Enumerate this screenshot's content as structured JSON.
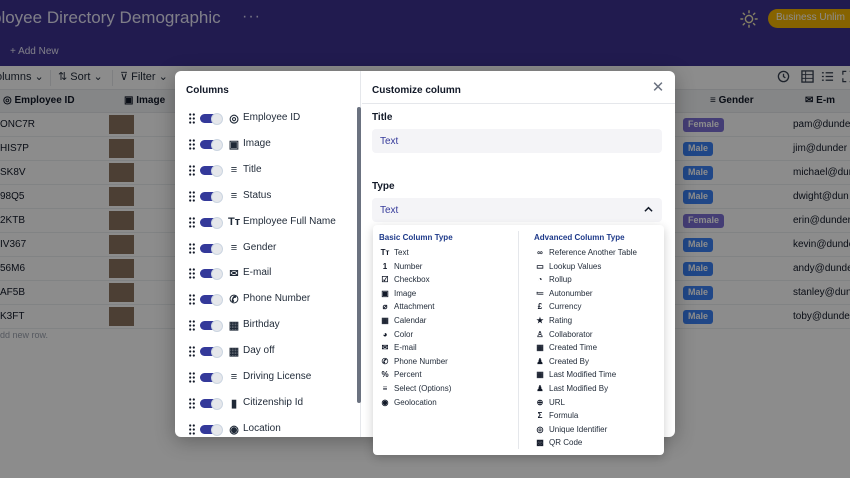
{
  "header": {
    "title": "ployee Directory Demographic",
    "more": "···",
    "plan_badge": "Business Unlim",
    "add_new": "+ Add New"
  },
  "toolbar": {
    "columns": "olumns ⌄",
    "sort": "⇅ Sort ⌄",
    "filter": "⊽ Filter ⌄",
    "history_icon": "history-icon",
    "grid_icon": "grid-view-icon",
    "list_icon": "list-view-icon",
    "expand_icon": "expand-icon"
  },
  "grid": {
    "headers": {
      "id": "Employee ID",
      "image": "Image",
      "gender": "Gender",
      "email": "E-m"
    },
    "rows": [
      {
        "id": "ONC7R",
        "gender": "Female",
        "email": "pam@dunder"
      },
      {
        "id": "HIS7P",
        "gender": "Male",
        "email": "jim@dunder"
      },
      {
        "id": "SK8V",
        "gender": "Male",
        "email": "michael@dun"
      },
      {
        "id": "98Q5",
        "gender": "Male",
        "email": "dwight@dun"
      },
      {
        "id": "2KTB",
        "gender": "Female",
        "email": "erin@dunder"
      },
      {
        "id": "IV367",
        "gender": "Male",
        "email": "kevin@dunde"
      },
      {
        "id": "56M6",
        "gender": "Male",
        "email": "andy@dunder"
      },
      {
        "id": "AF5B",
        "gender": "Male",
        "email": "stanley@dun"
      },
      {
        "id": "K3FT",
        "gender": "Male",
        "email": "toby@dunder"
      }
    ],
    "add_row": "dd new row.",
    "colors": {
      "female": "#7c6fd6",
      "male": "#3b82f6"
    }
  },
  "columns_panel": {
    "title": "Columns",
    "items": [
      {
        "icon": "fingerprint-icon",
        "glyph": "◎",
        "label": "Employee ID"
      },
      {
        "icon": "image-icon",
        "glyph": "▣",
        "label": "Image"
      },
      {
        "icon": "single-select-icon",
        "glyph": "≡",
        "label": "Title"
      },
      {
        "icon": "single-select-icon",
        "glyph": "≡",
        "label": "Status"
      },
      {
        "icon": "text-icon",
        "glyph": "Tт",
        "label": "Employee Full Name"
      },
      {
        "icon": "single-select-icon",
        "glyph": "≡",
        "label": "Gender"
      },
      {
        "icon": "email-icon",
        "glyph": "✉",
        "label": "E-mail"
      },
      {
        "icon": "phone-icon",
        "glyph": "✆",
        "label": "Phone Number"
      },
      {
        "icon": "calendar-icon",
        "glyph": "▦",
        "label": "Birthday"
      },
      {
        "icon": "calendar-icon",
        "glyph": "▦",
        "label": "Day off"
      },
      {
        "icon": "single-select-icon",
        "glyph": "≡",
        "label": "Driving License"
      },
      {
        "icon": "number-icon",
        "glyph": "▮",
        "label": "Citizenship Id"
      },
      {
        "icon": "location-icon",
        "glyph": "◉",
        "label": "Location"
      }
    ]
  },
  "customize": {
    "title": "Customize column",
    "title_label": "Title",
    "title_value": "Text",
    "type_label": "Type",
    "type_value": "Text"
  },
  "type_dropdown": {
    "basic_header": "Basic Column Type",
    "advanced_header": "Advanced Column Type",
    "basic": [
      {
        "icon": "text-icon",
        "glyph": "Tт",
        "label": "Text"
      },
      {
        "icon": "number-icon",
        "glyph": "1",
        "label": "Number"
      },
      {
        "icon": "checkbox-icon",
        "glyph": "☑",
        "label": "Checkbox"
      },
      {
        "icon": "image-icon",
        "glyph": "▣",
        "label": "Image"
      },
      {
        "icon": "attachment-icon",
        "glyph": "⌀",
        "label": "Attachment"
      },
      {
        "icon": "calendar-icon",
        "glyph": "▦",
        "label": "Calendar"
      },
      {
        "icon": "palette-icon",
        "glyph": "◕",
        "label": "Color"
      },
      {
        "icon": "email-icon",
        "glyph": "✉",
        "label": "E-mail"
      },
      {
        "icon": "phone-icon",
        "glyph": "✆",
        "label": "Phone Number"
      },
      {
        "icon": "percent-icon",
        "glyph": "%",
        "label": "Percent"
      },
      {
        "icon": "select-icon",
        "glyph": "≡",
        "label": "Select (Options)"
      },
      {
        "icon": "location-icon",
        "glyph": "◉",
        "label": "Geolocation"
      }
    ],
    "advanced": [
      {
        "icon": "link-icon",
        "glyph": "∞",
        "label": "Reference Another Table"
      },
      {
        "icon": "lookup-icon",
        "glyph": "▭",
        "label": "Lookup Values"
      },
      {
        "icon": "rollup-icon",
        "glyph": "◔",
        "label": "Rollup"
      },
      {
        "icon": "autonumber-icon",
        "glyph": "≔",
        "label": "Autonumber"
      },
      {
        "icon": "currency-icon",
        "glyph": "£",
        "label": "Currency"
      },
      {
        "icon": "star-icon",
        "glyph": "★",
        "label": "Rating"
      },
      {
        "icon": "collaborator-icon",
        "glyph": "♙",
        "label": "Collaborator"
      },
      {
        "icon": "created-time-icon",
        "glyph": "▦",
        "label": "Created Time"
      },
      {
        "icon": "created-by-icon",
        "glyph": "♟",
        "label": "Created By"
      },
      {
        "icon": "modified-time-icon",
        "glyph": "▦",
        "label": "Last Modified Time"
      },
      {
        "icon": "modified-by-icon",
        "glyph": "♟",
        "label": "Last Modified By"
      },
      {
        "icon": "globe-icon",
        "glyph": "⊕",
        "label": "URL"
      },
      {
        "icon": "formula-icon",
        "glyph": "Σ",
        "label": "Formula"
      },
      {
        "icon": "fingerprint-icon",
        "glyph": "◎",
        "label": "Unique Identifier"
      },
      {
        "icon": "qr-code-icon",
        "glyph": "▩",
        "label": "QR Code"
      }
    ]
  }
}
